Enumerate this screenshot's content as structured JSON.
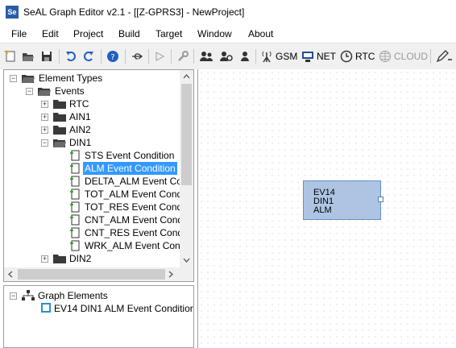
{
  "window": {
    "title": "SeAL Graph Editor v2.1 - [[Z-GPRS3] - NewProject]",
    "app_icon_text": "Se"
  },
  "menu": [
    "File",
    "Edit",
    "Project",
    "Build",
    "Target",
    "Window",
    "About"
  ],
  "toolbar": {
    "gsm": "GSM",
    "net": "NET",
    "rtc": "RTC",
    "cloud": "CLOUD"
  },
  "element_tree": {
    "root": "Element Types",
    "events": "Events",
    "rtc": "RTC",
    "ain1": "AIN1",
    "ain2": "AIN2",
    "din1": "DIN1",
    "din1_children": [
      "STS Event Condition",
      "ALM Event Condition",
      "DELTA_ALM Event Condition",
      "TOT_ALM Event Condition",
      "TOT_RES Event Condition",
      "CNT_ALM Event Condition",
      "CNT_RES Event Condition",
      "WRK_ALM Event Condition"
    ],
    "din2": "DIN2",
    "selected_item": "ALM Event Condition"
  },
  "graph_tree": {
    "root": "Graph Elements",
    "items": [
      "EV14 DIN1 ALM Event Condition"
    ]
  },
  "canvas": {
    "node": {
      "lines": [
        "EV14",
        "DIN1",
        "ALM"
      ],
      "fill": "#adc5e3"
    }
  },
  "colors": {
    "selection": "#3399ff",
    "node_fill": "#adc5e3",
    "app_icon": "#2a5da8"
  }
}
